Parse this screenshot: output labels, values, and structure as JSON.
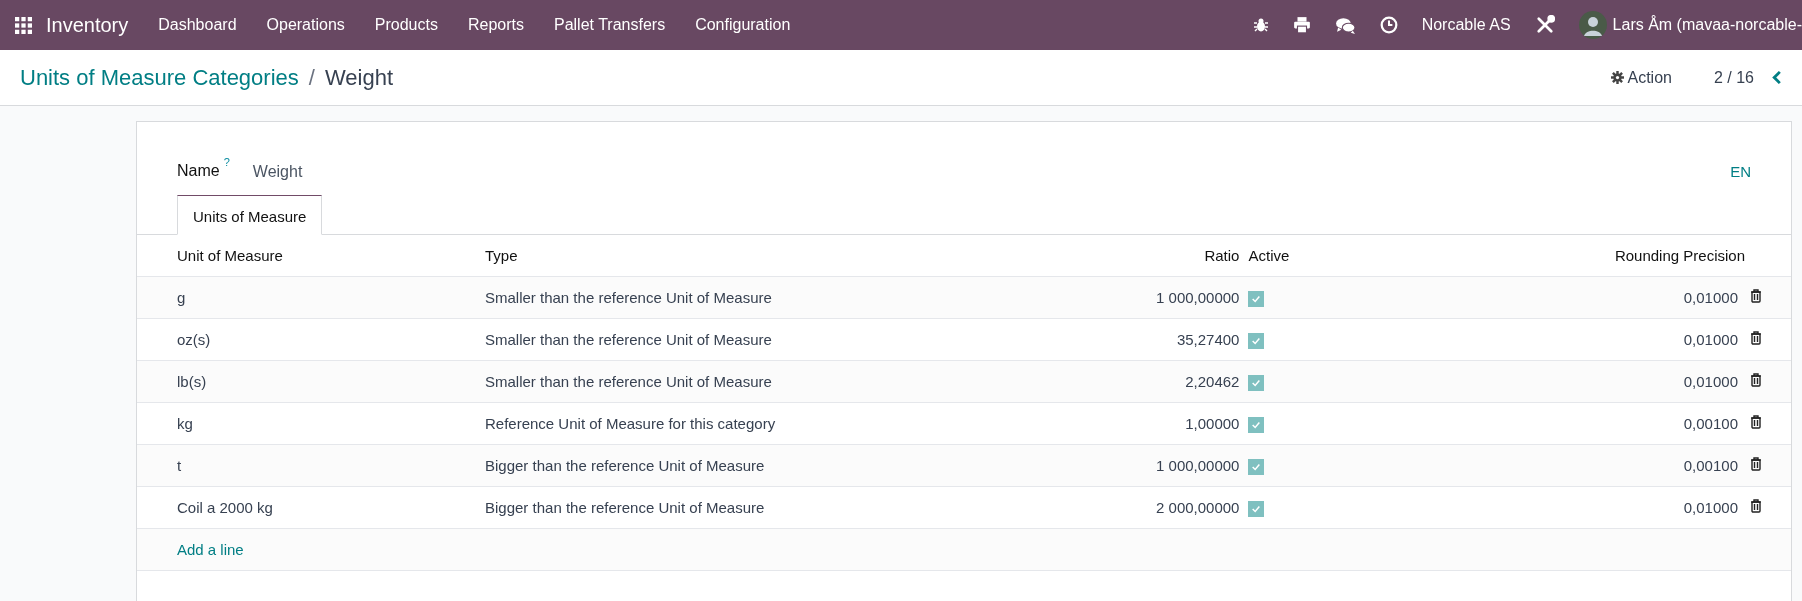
{
  "navbar": {
    "app_name": "Inventory",
    "menu": [
      "Dashboard",
      "Operations",
      "Products",
      "Reports",
      "Pallet Transfers",
      "Configuration"
    ],
    "company": "Norcable AS",
    "user": "Lars Åm (mavaa-norcable-"
  },
  "breadcrumb": {
    "parent": "Units of Measure Categories",
    "separator": "/",
    "current": "Weight"
  },
  "control_panel": {
    "action": "Action",
    "pager": "2 / 16"
  },
  "form": {
    "name_label": "Name",
    "help_mark": "?",
    "name_value": "Weight",
    "language": "EN",
    "tabs": [
      {
        "label": "Units of Measure",
        "selected": true
      }
    ],
    "table": {
      "columns": [
        "Unit of Measure",
        "Type",
        "Ratio",
        "Active",
        "Rounding Precision"
      ],
      "rows": [
        {
          "unit": "g",
          "type": "Smaller than the reference Unit of Measure",
          "ratio": "1 000,00000",
          "active": true,
          "rounding": "0,01000"
        },
        {
          "unit": "oz(s)",
          "type": "Smaller than the reference Unit of Measure",
          "ratio": "35,27400",
          "active": true,
          "rounding": "0,01000"
        },
        {
          "unit": "lb(s)",
          "type": "Smaller than the reference Unit of Measure",
          "ratio": "2,20462",
          "active": true,
          "rounding": "0,01000"
        },
        {
          "unit": "kg",
          "type": "Reference Unit of Measure for this category",
          "ratio": "1,00000",
          "active": true,
          "rounding": "0,00100"
        },
        {
          "unit": "t",
          "type": "Bigger than the reference Unit of Measure",
          "ratio": "1 000,00000",
          "active": true,
          "rounding": "0,00100"
        },
        {
          "unit": "Coil a 2000 kg",
          "type": "Bigger than the reference Unit of Measure",
          "ratio": "2 000,00000",
          "active": true,
          "rounding": "0,01000"
        }
      ],
      "add_line": "Add a line"
    }
  }
}
